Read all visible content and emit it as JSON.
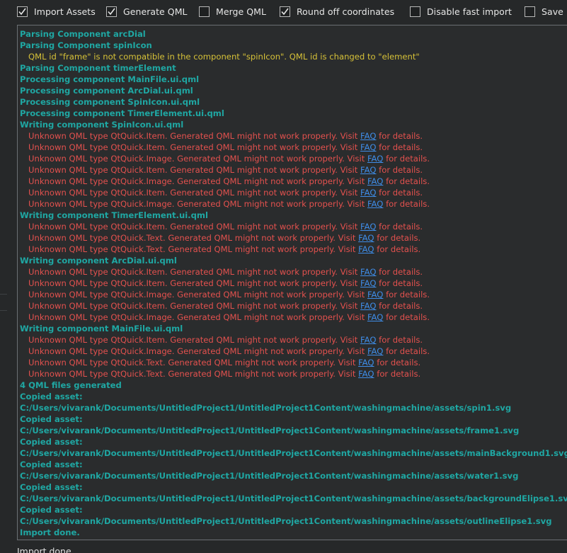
{
  "options": [
    {
      "label": "Import Assets",
      "checked": true
    },
    {
      "label": "Generate QML",
      "checked": true
    },
    {
      "label": "Merge QML",
      "checked": false
    },
    {
      "label": "Round off coordinates",
      "checked": true
    },
    {
      "label": "Disable fast import",
      "checked": false
    },
    {
      "label": "Save Lo",
      "checked": false
    }
  ],
  "log": {
    "faq_label": "FAQ",
    "lines": [
      {
        "kind": "info",
        "text": "Parsing Component arcDial"
      },
      {
        "kind": "info",
        "text": "Parsing Component spinIcon"
      },
      {
        "kind": "warn",
        "text": "QML id \"frame\" is not compatible in the component \"spinIcon\". QML id is changed to \"element\""
      },
      {
        "kind": "info",
        "text": "Parsing Component timerElement"
      },
      {
        "kind": "info",
        "text": "Processing component MainFile.ui.qml"
      },
      {
        "kind": "info",
        "text": "Processing component ArcDial.ui.qml"
      },
      {
        "kind": "info",
        "text": "Processing component SpinIcon.ui.qml"
      },
      {
        "kind": "info",
        "text": "Processing component TimerElement.ui.qml"
      },
      {
        "kind": "info",
        "text": "Writing component SpinIcon.ui.qml"
      },
      {
        "kind": "err",
        "pre": "Unknown QML type QtQuick.Item. Generated QML might not work properly. Visit ",
        "post": " for details."
      },
      {
        "kind": "err",
        "pre": "Unknown QML type QtQuick.Item. Generated QML might not work properly. Visit ",
        "post": " for details."
      },
      {
        "kind": "err",
        "pre": "Unknown QML type QtQuick.Image. Generated QML might not work properly. Visit ",
        "post": " for details."
      },
      {
        "kind": "err",
        "pre": "Unknown QML type QtQuick.Item. Generated QML might not work properly. Visit ",
        "post": " for details."
      },
      {
        "kind": "err",
        "pre": "Unknown QML type QtQuick.Image. Generated QML might not work properly. Visit ",
        "post": " for details."
      },
      {
        "kind": "err",
        "pre": "Unknown QML type QtQuick.Item. Generated QML might not work properly. Visit ",
        "post": " for details."
      },
      {
        "kind": "err",
        "pre": "Unknown QML type QtQuick.Image. Generated QML might not work properly. Visit ",
        "post": " for details."
      },
      {
        "kind": "info",
        "text": "Writing component TimerElement.ui.qml"
      },
      {
        "kind": "err",
        "pre": "Unknown QML type QtQuick.Item. Generated QML might not work properly. Visit ",
        "post": " for details."
      },
      {
        "kind": "err",
        "pre": "Unknown QML type QtQuick.Text. Generated QML might not work properly. Visit ",
        "post": " for details."
      },
      {
        "kind": "err",
        "pre": "Unknown QML type QtQuick.Text. Generated QML might not work properly. Visit ",
        "post": " for details."
      },
      {
        "kind": "info",
        "text": "Writing component ArcDial.ui.qml"
      },
      {
        "kind": "err",
        "pre": "Unknown QML type QtQuick.Item. Generated QML might not work properly. Visit ",
        "post": " for details."
      },
      {
        "kind": "err",
        "pre": "Unknown QML type QtQuick.Item. Generated QML might not work properly. Visit ",
        "post": " for details."
      },
      {
        "kind": "err",
        "pre": "Unknown QML type QtQuick.Image. Generated QML might not work properly. Visit ",
        "post": " for details."
      },
      {
        "kind": "err",
        "pre": "Unknown QML type QtQuick.Item. Generated QML might not work properly. Visit ",
        "post": " for details."
      },
      {
        "kind": "err",
        "pre": "Unknown QML type QtQuick.Image. Generated QML might not work properly. Visit ",
        "post": " for details."
      },
      {
        "kind": "info",
        "text": "Writing component MainFile.ui.qml"
      },
      {
        "kind": "err",
        "pre": "Unknown QML type QtQuick.Item. Generated QML might not work properly. Visit ",
        "post": " for details."
      },
      {
        "kind": "err",
        "pre": "Unknown QML type QtQuick.Image. Generated QML might not work properly. Visit ",
        "post": " for details."
      },
      {
        "kind": "err",
        "pre": "Unknown QML type QtQuick.Text. Generated QML might not work properly. Visit ",
        "post": " for details."
      },
      {
        "kind": "err",
        "pre": "Unknown QML type QtQuick.Text. Generated QML might not work properly. Visit ",
        "post": " for details."
      },
      {
        "kind": "info",
        "text": "4 QML files generated"
      },
      {
        "kind": "info",
        "text": "Copied asset:"
      },
      {
        "kind": "info",
        "text": "C:/Users/vivarank/Documents/UntitledProject1/UntitledProject1Content/washingmachine/assets/spin1.svg"
      },
      {
        "kind": "info",
        "text": "Copied asset:"
      },
      {
        "kind": "info",
        "text": "C:/Users/vivarank/Documents/UntitledProject1/UntitledProject1Content/washingmachine/assets/frame1.svg"
      },
      {
        "kind": "info",
        "text": "Copied asset:"
      },
      {
        "kind": "info",
        "text": "C:/Users/vivarank/Documents/UntitledProject1/UntitledProject1Content/washingmachine/assets/mainBackground1.svg"
      },
      {
        "kind": "info",
        "text": "Copied asset:"
      },
      {
        "kind": "info",
        "text": "C:/Users/vivarank/Documents/UntitledProject1/UntitledProject1Content/washingmachine/assets/water1.svg"
      },
      {
        "kind": "info",
        "text": "Copied asset:"
      },
      {
        "kind": "info",
        "text": "C:/Users/vivarank/Documents/UntitledProject1/UntitledProject1Content/washingmachine/assets/backgroundElipse1.svg"
      },
      {
        "kind": "info",
        "text": "Copied asset:"
      },
      {
        "kind": "info",
        "text": "C:/Users/vivarank/Documents/UntitledProject1/UntitledProject1Content/washingmachine/assets/outlineElipse1.svg"
      },
      {
        "kind": "info",
        "text": "Import done."
      }
    ]
  },
  "status": {
    "text": "Import done"
  },
  "colors": {
    "background": "#262829",
    "log_background": "#2a2c2d",
    "info": "#1fa7a3",
    "warning": "#d6c138",
    "error": "#e3514e",
    "link": "#3f8de8"
  }
}
